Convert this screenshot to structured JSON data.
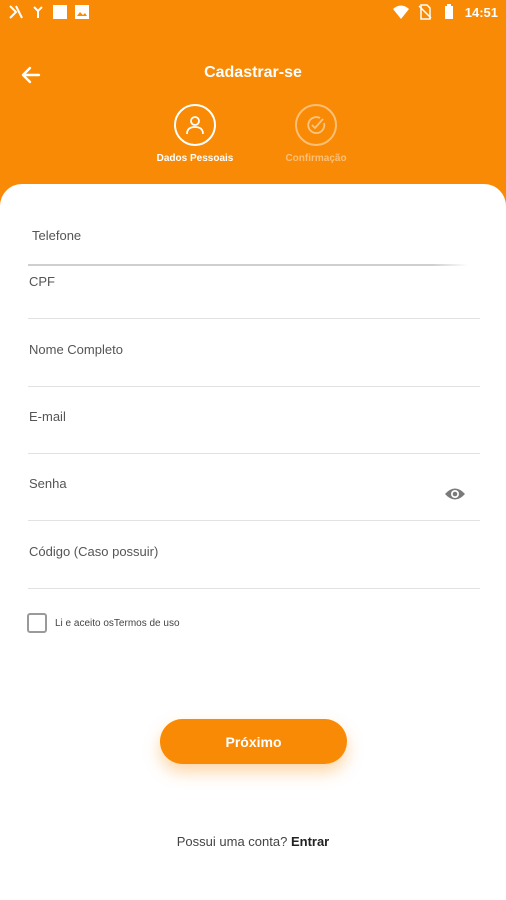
{
  "status_bar": {
    "time": "14:51",
    "left_icons": [
      "x-logo-icon",
      "missed-call-icon",
      "square-notification-icon",
      "image-notification-icon"
    ],
    "right_icons": [
      "wifi-icon",
      "no-sim-icon",
      "battery-icon"
    ]
  },
  "header": {
    "title": "Cadastrar-se",
    "steps": [
      {
        "label": "Dados Pessoais",
        "icon": "person-icon",
        "state": "active"
      },
      {
        "label": "Confirmação",
        "icon": "check-circle-icon",
        "state": "inactive"
      }
    ]
  },
  "form": {
    "fields": [
      {
        "label": "Telefone"
      },
      {
        "label": "CPF"
      },
      {
        "label": "Nome Completo"
      },
      {
        "label": "E-mail"
      },
      {
        "label": "Senha"
      },
      {
        "label": "Código (Caso possuir)"
      }
    ],
    "terms_label": "Li e aceito osTermos de uso",
    "terms_checked": false,
    "next_label": "Próximo"
  },
  "footer": {
    "prompt": "Possui uma conta?",
    "login_label": "Entrar"
  },
  "colors": {
    "accent": "#F98A05"
  }
}
